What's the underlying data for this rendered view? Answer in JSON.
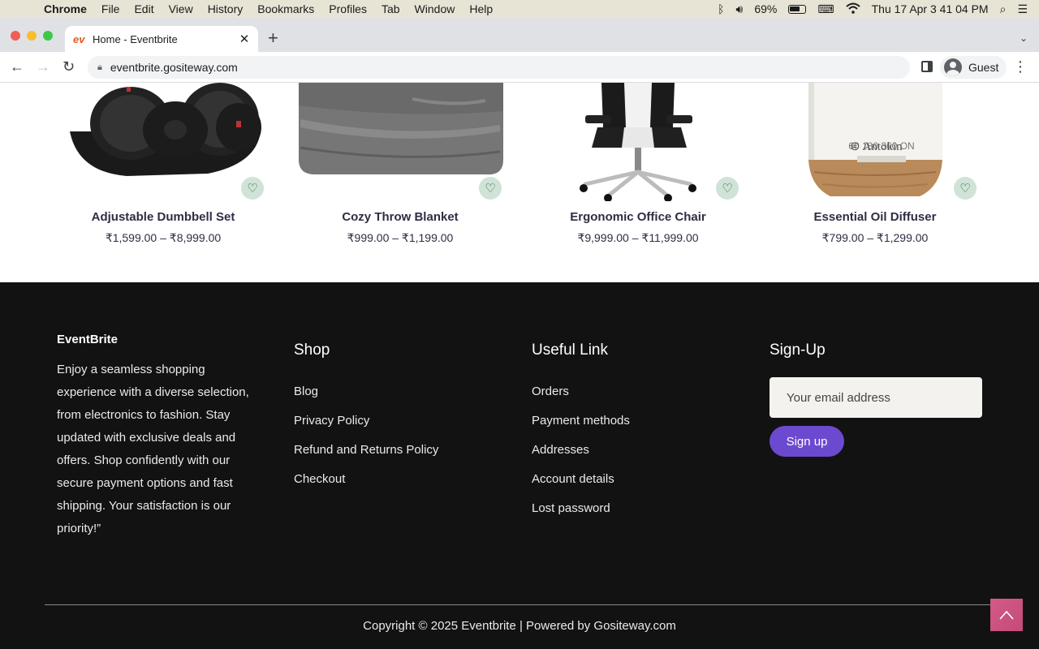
{
  "os_menubar": {
    "app": "Chrome",
    "items": [
      "File",
      "Edit",
      "View",
      "History",
      "Bookmarks",
      "Profiles",
      "Tab",
      "Window",
      "Help"
    ],
    "battery": "69%",
    "clock": "Thu 17 Apr  3 41 04 PM"
  },
  "browser": {
    "tab_title": "Home - Eventbrite",
    "tab_favicon": "ev",
    "url": "eventbrite.gositeway.com",
    "profile": "Guest"
  },
  "products": [
    {
      "name": "Adjustable Dumbbell Set",
      "price": "₹1,599.00 – ₹8,999.00"
    },
    {
      "name": "Cozy Throw Blanket",
      "price": "₹999.00 – ₹1,199.00"
    },
    {
      "name": "Ergonomic Office Chair",
      "price": "₹9,999.00 – ₹11,999.00"
    },
    {
      "name": "Essential Oil Diffuser",
      "price": "₹799.00 – ₹1,299.00"
    }
  ],
  "diffuser_label": {
    "brand": "Antokin",
    "settings": "60  180  360  ON"
  },
  "footer": {
    "brand": "EventBrite",
    "about": "Enjoy a seamless shopping experience with a diverse selection, from electronics to fashion. Stay updated with exclusive deals and offers. Shop confidently with our secure payment options and fast shipping. Your satisfaction is our priority!”",
    "shop": {
      "heading": "Shop",
      "links": [
        "Blog",
        "Privacy Policy",
        "Refund and Returns Policy",
        "Checkout"
      ]
    },
    "useful": {
      "heading": "Useful Link",
      "links": [
        "Orders",
        "Payment methods",
        "Addresses",
        "Account details",
        "Lost password"
      ]
    },
    "signup": {
      "heading": "Sign-Up",
      "placeholder": "Your email address",
      "button": "Sign up"
    },
    "copyright": "Copyright © 2025 Eventbrite | Powered by Gositeway.com"
  },
  "colors": {
    "accent": "#6c4ad0",
    "footer_bg": "#121212",
    "wishlist_bg": "#cfe3d6",
    "scroll_top": "#d45a86"
  }
}
